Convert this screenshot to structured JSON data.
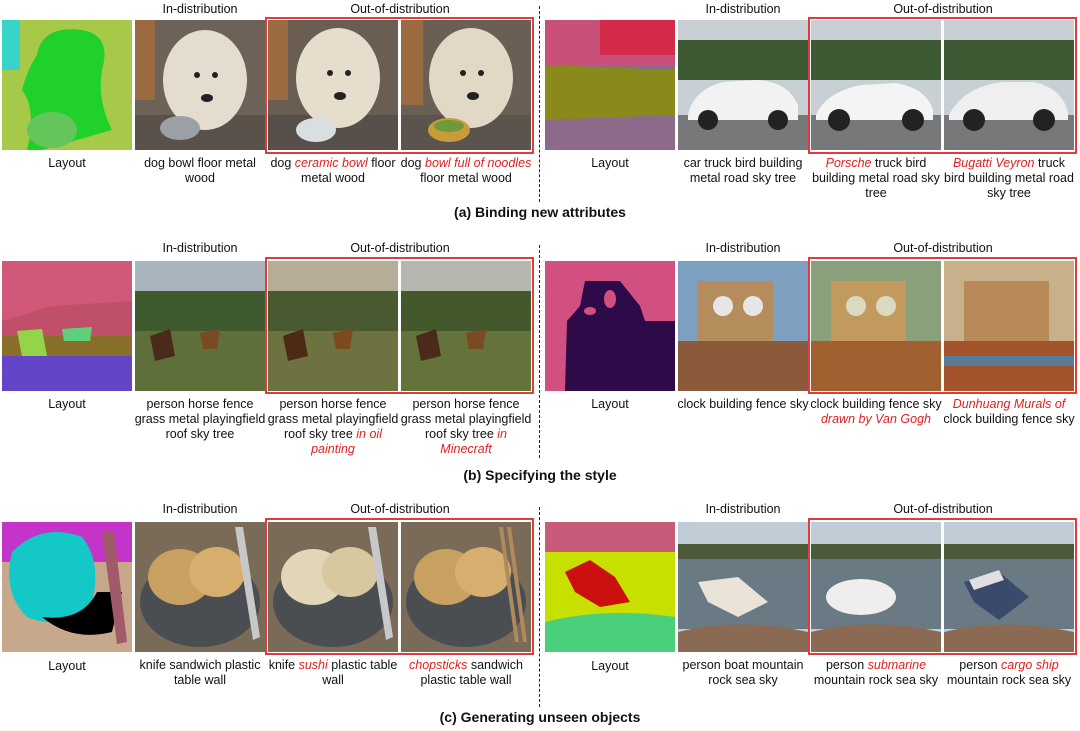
{
  "headers": {
    "in": "In-distribution",
    "out": "Out-of-distribution"
  },
  "layout_label": "Layout",
  "sections": [
    {
      "title": "(a) Binding new attributes",
      "left": [
        [
          {
            "t": "dog bowl floor metal wood"
          }
        ],
        [
          {
            "t": "dog "
          },
          {
            "t": "ceramic bowl",
            "r": true
          },
          {
            "t": " floor metal wood"
          }
        ],
        [
          {
            "t": "dog "
          },
          {
            "t": "bowl full of noodles",
            "r": true
          },
          {
            "t": " floor metal wood"
          }
        ]
      ],
      "right": [
        [
          {
            "t": "car truck bird building metal road sky tree"
          }
        ],
        [
          {
            "t": "Porsche",
            "r": true
          },
          {
            "t": " truck bird building metal road sky tree"
          }
        ],
        [
          {
            "t": "Bugatti Veyron",
            "r": true
          },
          {
            "t": " truck bird building metal road sky tree"
          }
        ]
      ]
    },
    {
      "title": "(b) Specifying the style",
      "left": [
        [
          {
            "t": "person horse fence grass metal playingfield roof sky tree"
          }
        ],
        [
          {
            "t": "person horse fence grass metal playingfield roof sky tree "
          },
          {
            "t": "in oil painting",
            "r": true
          }
        ],
        [
          {
            "t": "person horse fence grass metal playingfield roof sky tree "
          },
          {
            "t": "in Minecraft",
            "r": true
          }
        ]
      ],
      "right": [
        [
          {
            "t": "clock building fence sky"
          }
        ],
        [
          {
            "t": "clock building fence sky "
          },
          {
            "t": "drawn by Van Gogh",
            "r": true
          }
        ],
        [
          {
            "t": "Dunhuang Murals of",
            "r": true
          },
          {
            "t": " clock building fence sky"
          }
        ]
      ]
    },
    {
      "title": "(c) Generating unseen objects",
      "left": [
        [
          {
            "t": "knife sandwich plastic table wall"
          }
        ],
        [
          {
            "t": "knife "
          },
          {
            "t": "sushi",
            "r": true
          },
          {
            "t": " plastic table wall"
          }
        ],
        [
          {
            "t": "chopsticks",
            "r": true
          },
          {
            "t": " sandwich plastic table wall"
          }
        ]
      ],
      "right": [
        [
          {
            "t": "person boat mountain rock sea sky"
          }
        ],
        [
          {
            "t": "person "
          },
          {
            "t": "submarine",
            "r": true
          },
          {
            "t": " mountain rock sea sky"
          }
        ],
        [
          {
            "t": "person "
          },
          {
            "t": "cargo ship",
            "r": true
          },
          {
            "t": " mountain rock sea sky"
          }
        ]
      ]
    }
  ],
  "colors": {
    "ood_border": "#e23b3b",
    "highlight_text": "#e02020"
  }
}
